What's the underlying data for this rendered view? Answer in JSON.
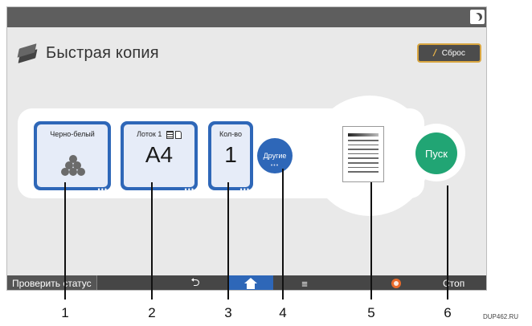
{
  "title": "Быстрая копия",
  "reset_label": "Сброс",
  "tiles": {
    "color": {
      "label": "Черно-белый"
    },
    "paper": {
      "label": "Лоток 1",
      "value": "A4"
    },
    "quantity": {
      "label": "Кол-во",
      "value": "1"
    }
  },
  "other_label": "Другие",
  "start_label": "Пуск",
  "bottom_bar": {
    "check_status": "Проверить статус",
    "stop": "Стоп"
  },
  "callouts": [
    "1",
    "2",
    "3",
    "4",
    "5",
    "6"
  ],
  "footer_code": "DUP462.RU",
  "colors": {
    "accent_blue": "#2e67b8",
    "start_green": "#21a574",
    "reset_border": "#d9a640"
  },
  "icons": [
    "moon-icon",
    "copy-app-icon",
    "reset-icon",
    "toner-icon",
    "tray-icon",
    "back-icon",
    "home-icon",
    "menu-icon",
    "stop-icon"
  ]
}
